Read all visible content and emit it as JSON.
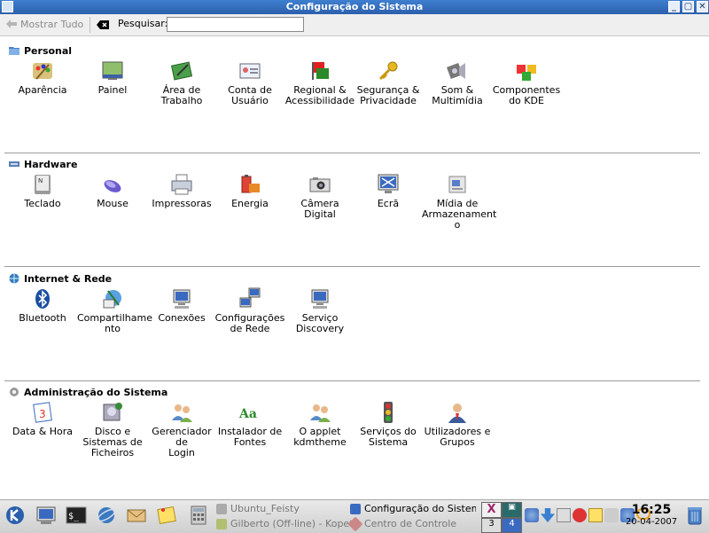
{
  "window": {
    "title": "Configuração do Sistema"
  },
  "toolbar": {
    "show_all": "Mostrar Tudo",
    "search_label": "Pesquisar:",
    "search_value": ""
  },
  "sections": [
    {
      "title": "Personal",
      "items": [
        {
          "label": "Aparência"
        },
        {
          "label": "Painel"
        },
        {
          "label": "Área de\nTrabalho"
        },
        {
          "label": "Conta de\nUsuário"
        },
        {
          "label": "Regional &\nAcessibilidade"
        },
        {
          "label": "Segurança &\nPrivacidade"
        },
        {
          "label": "Som &\nMultimídia"
        },
        {
          "label": "Componentes\ndo KDE"
        }
      ]
    },
    {
      "title": "Hardware",
      "items": [
        {
          "label": "Teclado"
        },
        {
          "label": "Mouse"
        },
        {
          "label": "Impressoras"
        },
        {
          "label": "Energia"
        },
        {
          "label": "Câmera Digital"
        },
        {
          "label": "Ecrã"
        },
        {
          "label": "Mídia de\nArmazenament\no"
        }
      ]
    },
    {
      "title": "Internet & Rede",
      "items": [
        {
          "label": "Bluetooth"
        },
        {
          "label": "Compartilhame\nnto"
        },
        {
          "label": "Conexões"
        },
        {
          "label": "Configurações\nde Rede"
        },
        {
          "label": "Serviço\nDiscovery"
        }
      ]
    },
    {
      "title": "Administração do Sistema",
      "items": [
        {
          "label": "Data & Hora"
        },
        {
          "label": "Disco e\nSistemas de\nFicheiros"
        },
        {
          "label": "Gerenciador de\nLogin"
        },
        {
          "label": "Instalador de\nFontes"
        },
        {
          "label": "O applet\nkdmtheme"
        },
        {
          "label": "Serviços do\nSistema"
        },
        {
          "label": "Utilizadores e\nGrupos"
        }
      ]
    }
  ],
  "taskbar": {
    "tasks": [
      {
        "label": "Ubuntu_Feisty"
      },
      {
        "label": "Gilberto (Off-line) - Kopete"
      },
      {
        "label": "Configuração do Sistema"
      },
      {
        "label": "Centro de Controle"
      }
    ],
    "desktop_numbers": [
      "3",
      "4"
    ],
    "clock": {
      "time": "16:25",
      "date": "20-04-2007"
    }
  }
}
